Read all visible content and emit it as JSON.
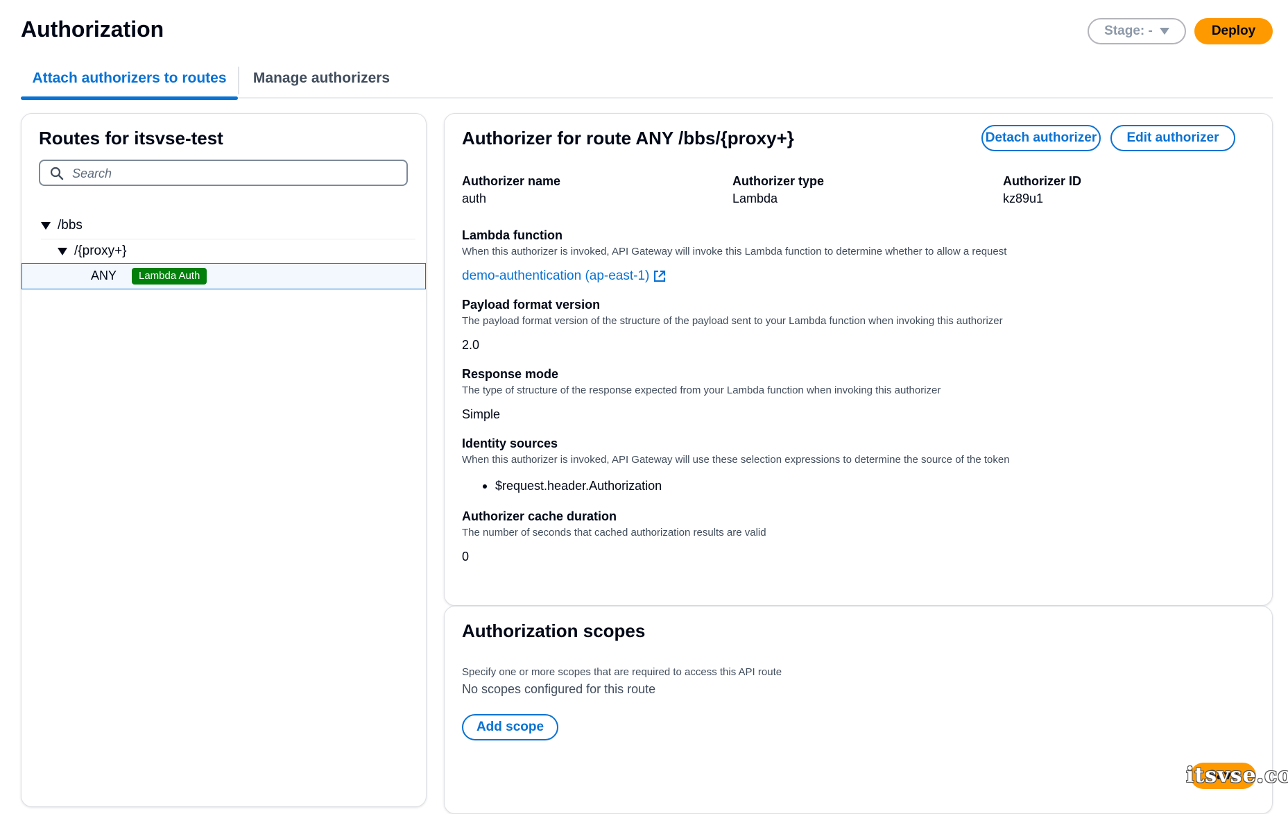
{
  "page": {
    "title": "Authorization",
    "stage_label": "Stage: -",
    "deploy_label": "Deploy"
  },
  "tabs": [
    {
      "label": "Attach authorizers to routes",
      "active": true
    },
    {
      "label": "Manage authorizers",
      "active": false
    }
  ],
  "routes": {
    "title": "Routes for itsvse-test",
    "search_placeholder": "Search",
    "tree": {
      "root": "/bbs",
      "child": "/{proxy+}",
      "method": "ANY",
      "badge": "Lambda Auth"
    }
  },
  "authorizer": {
    "title": "Authorizer for route ANY /bbs/{proxy+}",
    "detach_label": "Detach authorizer",
    "edit_label": "Edit authorizer",
    "name_label": "Authorizer name",
    "name_value": "auth",
    "type_label": "Authorizer type",
    "type_value": "Lambda",
    "id_label": "Authorizer ID",
    "id_value": "kz89u1",
    "lambda_label": "Lambda function",
    "lambda_desc": "When this authorizer is invoked, API Gateway will invoke this Lambda function to determine whether to allow a request",
    "lambda_link": "demo-authentication (ap-east-1)",
    "payload_label": "Payload format version",
    "payload_desc": "The payload format version of the structure of the payload sent to your Lambda function when invoking this authorizer",
    "payload_value": "2.0",
    "response_label": "Response mode",
    "response_desc": "The type of structure of the response expected from your Lambda function when invoking this authorizer",
    "response_value": "Simple",
    "identity_label": "Identity sources",
    "identity_desc": "When this authorizer is invoked, API Gateway will use these selection expressions to determine the source of the token",
    "identity_items": [
      "$request.header.Authorization"
    ],
    "cache_label": "Authorizer cache duration",
    "cache_desc": "The number of seconds that cached authorization results are valid",
    "cache_value": "0"
  },
  "scopes": {
    "title": "Authorization scopes",
    "desc": "Specify one or more scopes that are required to access this API route",
    "empty": "No scopes configured for this route",
    "add_label": "Add scope",
    "save_label": "Save"
  },
  "watermark": "itsvse.com",
  "colors": {
    "primary": "#0972d3",
    "accent": "#ff9900",
    "badge": "#037f0c",
    "text": "#000716"
  }
}
